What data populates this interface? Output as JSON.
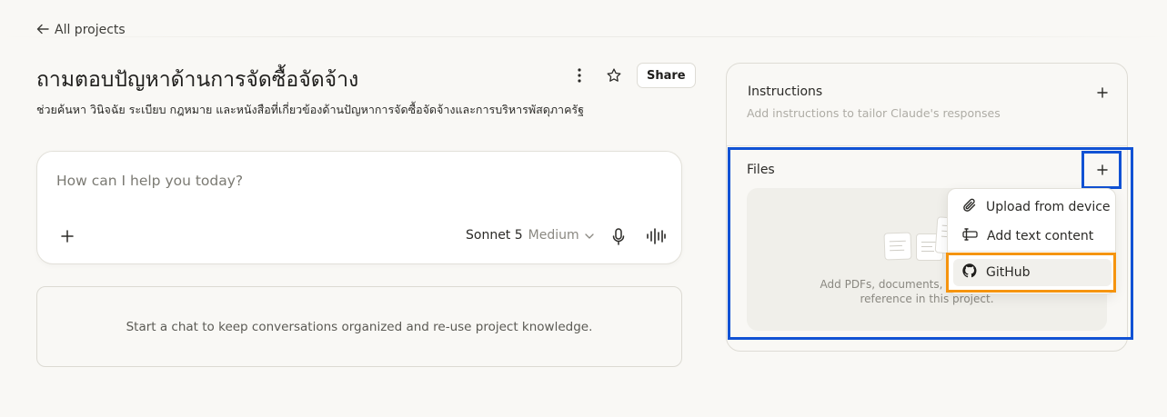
{
  "nav": {
    "back_label": "All projects"
  },
  "project": {
    "title": "ถามตอบปัญหาด้านการจัดซื้อจัดจ้าง",
    "description": "ช่วยค้นหา วินิจฉัย ระเบียบ กฎหมาย และหนังสือที่เกี่ยวข้องด้านปัญหาการจัดซื้อจัดจ้างและการบริหารพัสดุภาครัฐ",
    "share_label": "Share"
  },
  "composer": {
    "placeholder": "How can I help you today?",
    "model_name": "Sonnet 5",
    "model_mode": "Medium"
  },
  "chats": {
    "empty_text": "Start a chat to keep conversations organized and re-use project knowledge."
  },
  "instructions": {
    "title": "Instructions",
    "subtitle": "Add instructions to tailor Claude's responses"
  },
  "files": {
    "title": "Files",
    "drop_text_line1": "Add PDFs, documents,",
    "drop_text_line2": "reference in this project."
  },
  "files_menu": {
    "items": [
      {
        "label": "Upload from device",
        "icon": "paperclip-icon"
      },
      {
        "label": "Add text content",
        "icon": "text-cursor-icon"
      },
      {
        "label": "GitHub",
        "icon": "github-icon"
      }
    ]
  },
  "colors": {
    "background": "#f9f8f5",
    "highlight_blue": "#1152d4",
    "highlight_orange": "#f5940f"
  }
}
